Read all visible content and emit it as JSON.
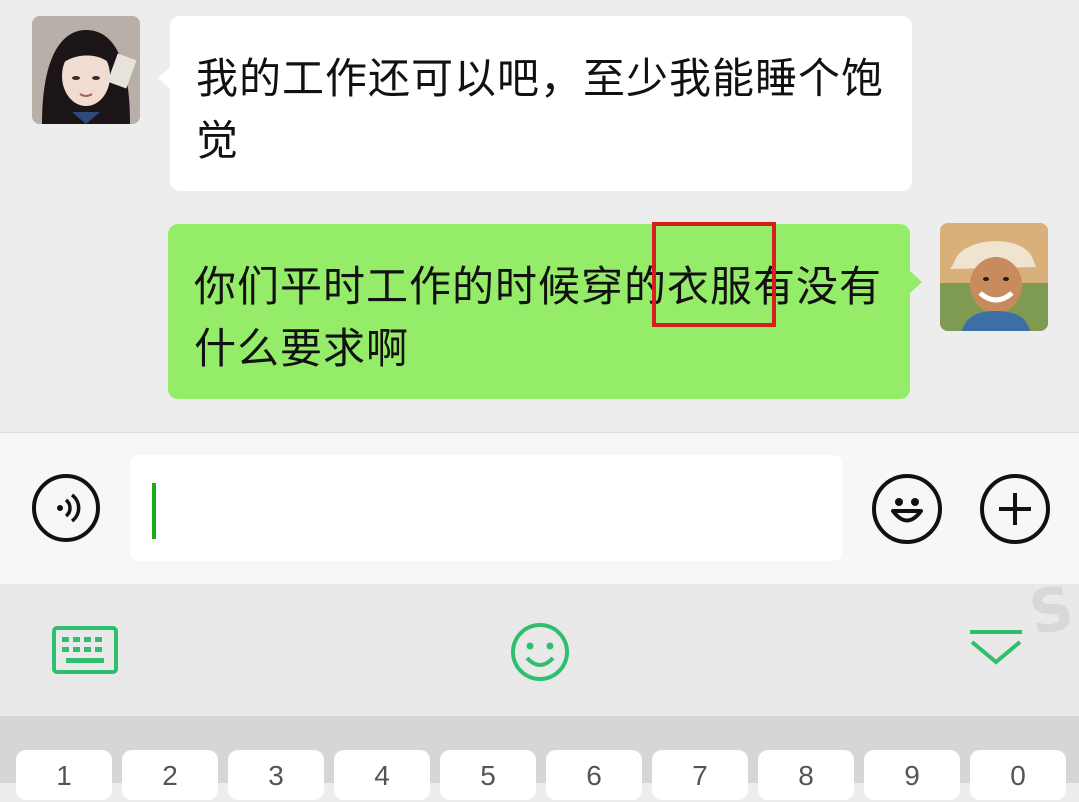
{
  "chat": {
    "messages": [
      {
        "sender": "other",
        "text": "我的工作还可以吧，至少我能睡个饱觉"
      },
      {
        "sender": "self",
        "text": "你们平时工作的时候穿的衣服有没有什么要求啊"
      }
    ],
    "highlight_color": "#d51f1f"
  },
  "input_bar": {
    "text_value": "",
    "icons": [
      "voice-icon",
      "emoji-icon",
      "plus-icon"
    ]
  },
  "keyboard_toolbar": {
    "icons": [
      "keyboard-icon",
      "emoji-panel-icon",
      "collapse-keyboard-icon"
    ],
    "accent_color": "#2fbf6f"
  },
  "keyboard": {
    "number_keys": [
      "1",
      "2",
      "3",
      "4",
      "5",
      "6",
      "7",
      "8",
      "9",
      "0"
    ]
  },
  "colors": {
    "sent_bubble": "#95ec69",
    "received_bubble": "#ffffff",
    "background": "#ededed"
  }
}
